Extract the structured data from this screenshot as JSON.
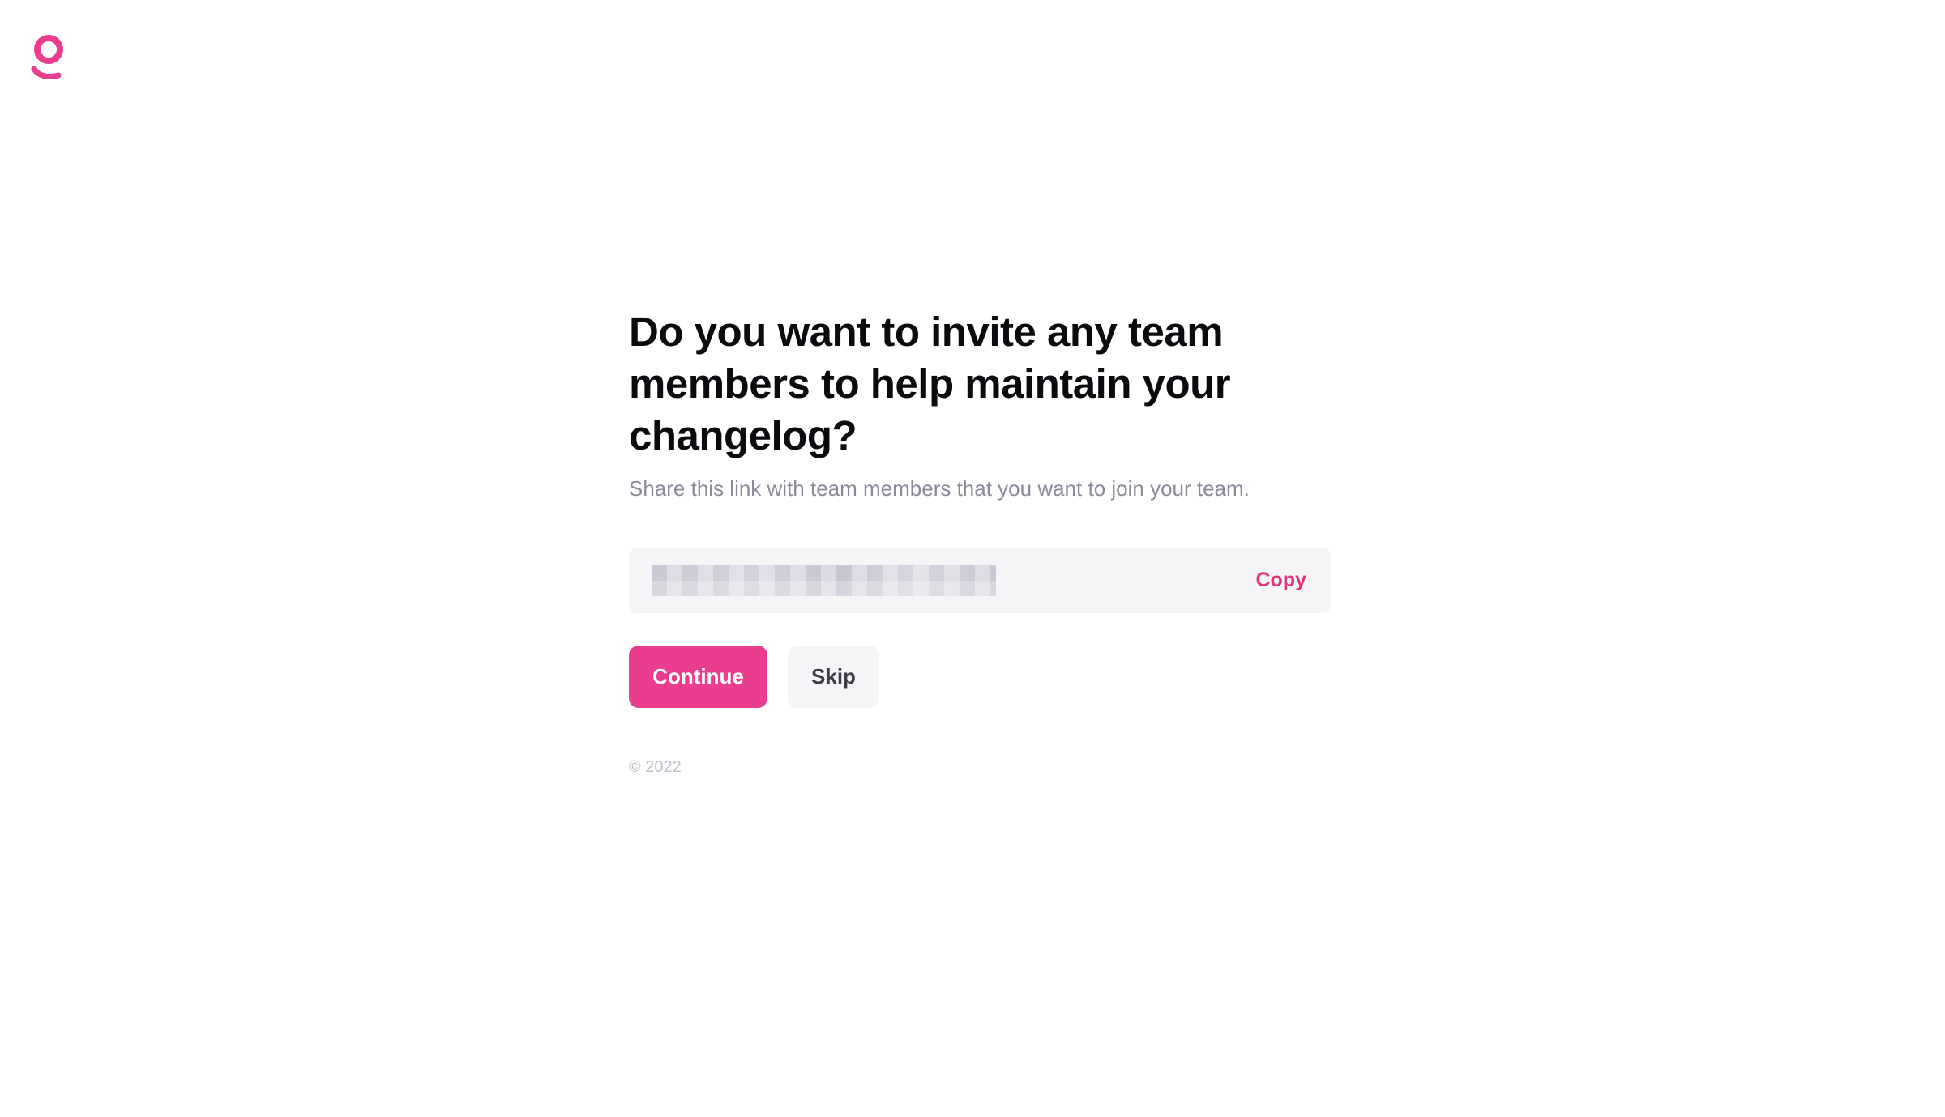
{
  "brand": {
    "logo_icon": "brand-logo-icon",
    "accent_color": "#ea3d8e"
  },
  "main": {
    "title": "Do you want to invite any team members to help maintain your changelog?",
    "subtitle": "Share this link with team members that you want to join your team.",
    "invite_link": {
      "value": "",
      "copy_label": "Copy"
    },
    "actions": {
      "continue_label": "Continue",
      "skip_label": "Skip"
    }
  },
  "footer": {
    "copyright": "© 2022"
  }
}
